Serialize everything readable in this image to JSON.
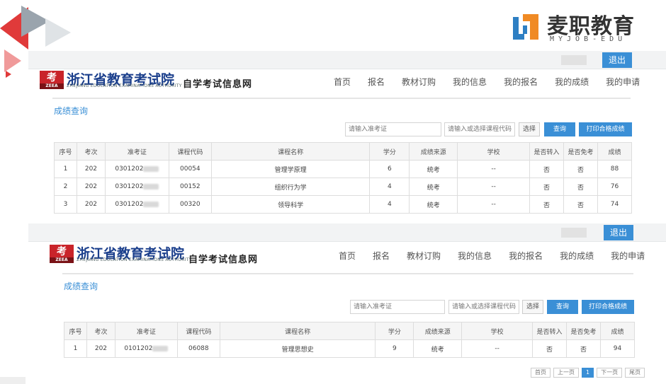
{
  "brand": {
    "name": "麦职教育",
    "sub": "MYJOB-EDU",
    "colors": {
      "orange": "#f08a24",
      "blue": "#2e7fc3"
    }
  },
  "site": {
    "logo_mark": "考",
    "logo_small": "ZEEA",
    "title": "浙江省教育考试院",
    "subtitle": "ZHEJIANG EDUCATION EXAMINATIONS AUTHORITY",
    "tag": "自学考试信息网",
    "logout": "退出",
    "nav": [
      "首页",
      "报名",
      "教材订购",
      "我的信息",
      "我的报名",
      "我的成绩",
      "我的申请"
    ]
  },
  "query": {
    "section_title": "成绩查询",
    "exam_id_placeholder": "请输入准考证",
    "course_placeholder": "请输入或选择课程代码",
    "select_label": "选择",
    "search_label": "查询",
    "print_label": "打印合格成绩"
  },
  "table": {
    "headers": [
      "序号",
      "考次",
      "准考证",
      "课程代码",
      "课程名称",
      "学分",
      "成绩来源",
      "学校",
      "是否转入",
      "是否免考",
      "成绩"
    ]
  },
  "pane1_rows": [
    {
      "no": "1",
      "session": "202",
      "exam_id": "0301202",
      "code": "00054",
      "name": "管理学原理",
      "credit": "6",
      "source": "统考",
      "school": "--",
      "transfer": "否",
      "exempt": "否",
      "score": "88"
    },
    {
      "no": "2",
      "session": "202",
      "exam_id": "0301202",
      "code": "00152",
      "name": "组织行为学",
      "credit": "4",
      "source": "统考",
      "school": "--",
      "transfer": "否",
      "exempt": "否",
      "score": "76"
    },
    {
      "no": "3",
      "session": "202",
      "exam_id": "0301202",
      "code": "00320",
      "name": "领导科学",
      "credit": "4",
      "source": "统考",
      "school": "--",
      "transfer": "否",
      "exempt": "否",
      "score": "74"
    }
  ],
  "pane2_rows": [
    {
      "no": "1",
      "session": "202",
      "exam_id": "0101202",
      "code": "06088",
      "name": "管理思想史",
      "credit": "9",
      "source": "统考",
      "school": "--",
      "transfer": "否",
      "exempt": "否",
      "score": "94"
    }
  ],
  "pager": {
    "first": "首页",
    "prev": "上一页",
    "current": "1",
    "next": "下一页",
    "last": "尾页"
  }
}
